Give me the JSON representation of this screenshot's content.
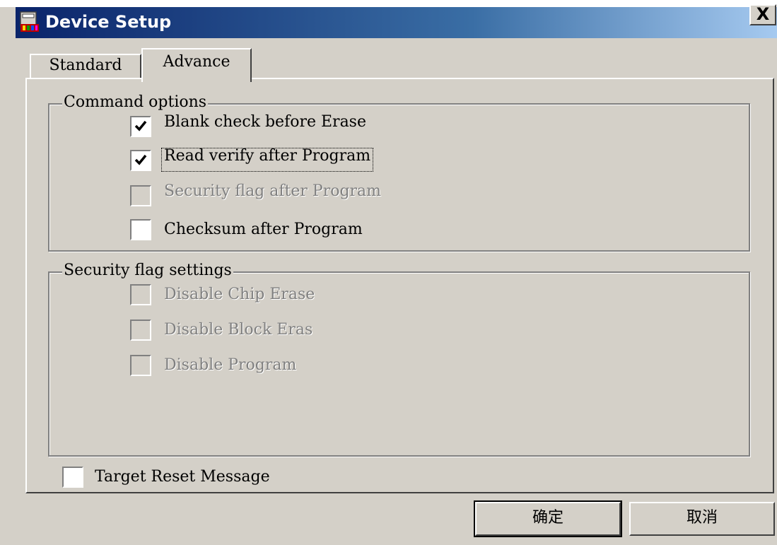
{
  "window": {
    "title": "Device Setup",
    "close_label": "X"
  },
  "tabs": [
    {
      "label": "Standard",
      "selected": false
    },
    {
      "label": "Advance",
      "selected": true
    }
  ],
  "command_options": {
    "legend": "Command options",
    "items": [
      {
        "label": "Blank check before Erase",
        "checked": true,
        "enabled": true
      },
      {
        "label": "Read verify after Program",
        "checked": true,
        "enabled": true,
        "focused": true
      },
      {
        "label": "Security flag after Program",
        "checked": false,
        "enabled": false
      },
      {
        "label": "Checksum after Program",
        "checked": false,
        "enabled": true
      }
    ]
  },
  "security_flag_settings": {
    "legend": "Security flag settings",
    "items": [
      {
        "label": "Disable Chip Erase",
        "checked": false,
        "enabled": false
      },
      {
        "label": "Disable Block Eras",
        "checked": false,
        "enabled": false
      },
      {
        "label": "Disable Program",
        "checked": false,
        "enabled": false
      }
    ]
  },
  "target_reset": {
    "label": "Target Reset Message",
    "checked": false,
    "enabled": true
  },
  "buttons": {
    "ok_label": "确定",
    "cancel_label": "取消"
  },
  "colors": {
    "titlebar_start": "#0a246a",
    "titlebar_end": "#a6caf0",
    "face": "#d4d0c8",
    "disabled_text": "#808080"
  },
  "icons": {
    "title": "app-icon",
    "checkmark": "check-icon"
  }
}
